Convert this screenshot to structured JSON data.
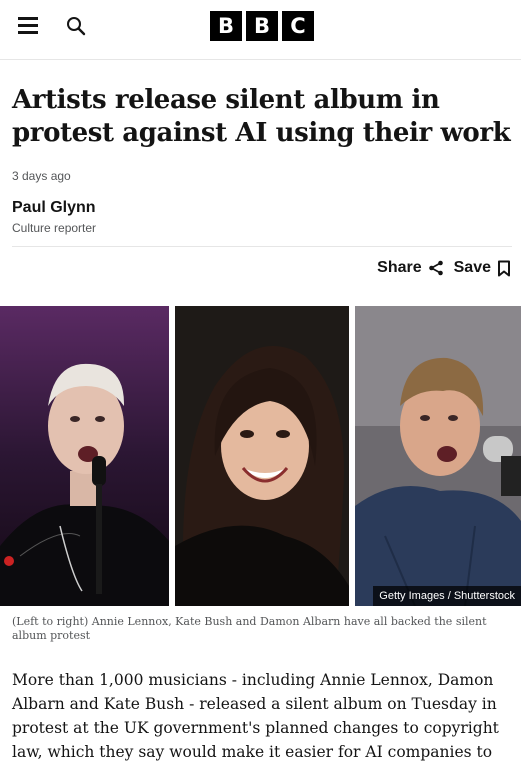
{
  "header": {
    "logo_letters": [
      "B",
      "B",
      "C"
    ],
    "menu_icon": "hamburger-menu-icon",
    "search_icon": "search-icon"
  },
  "article": {
    "headline": "Artists release silent album in protest against AI using their work",
    "timestamp": "3 days ago",
    "author": "Paul Glynn",
    "author_role": "Culture reporter",
    "share_label": "Share",
    "save_label": "Save",
    "image_credit": "Getty Images / Shutterstock",
    "image_caption": "(Left to right) Annie Lennox, Kate Bush and Damon Albarn have all backed the silent album protest",
    "body": "More than 1,000 musicians - including Annie Lennox, Damon Albarn and Kate Bush - released a silent album on Tuesday in protest at the UK government's planned changes to copyright law, which they say would make it easier for AI companies to train"
  },
  "colors": {
    "text": "#141414",
    "muted": "#545658",
    "divider": "#e6e6e6",
    "logo_bg": "#000000"
  }
}
